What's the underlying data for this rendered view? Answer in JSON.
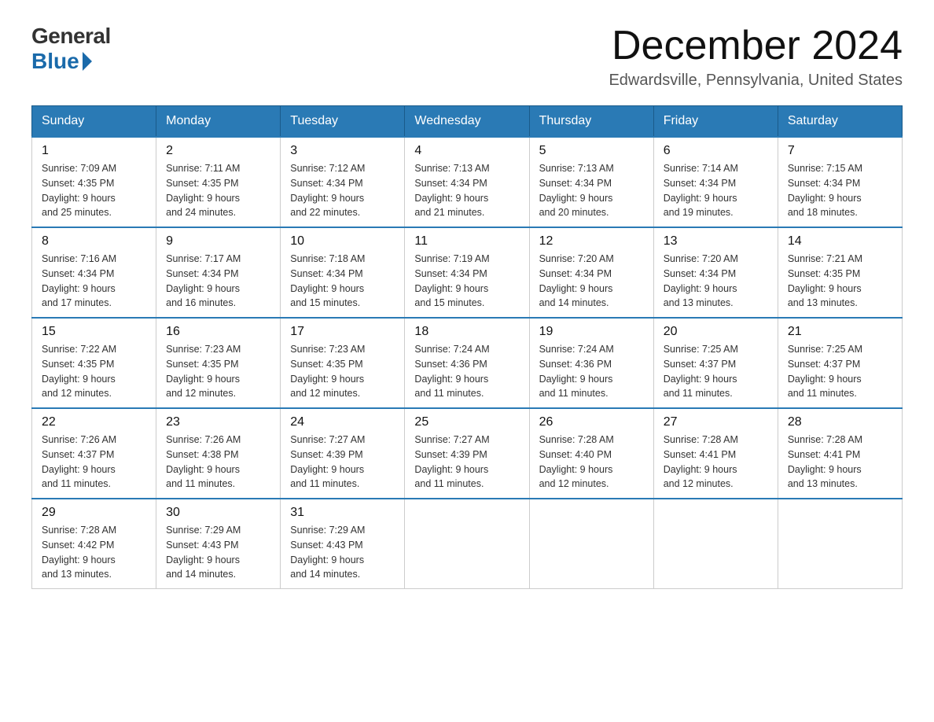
{
  "header": {
    "logo": {
      "general": "General",
      "blue": "Blue"
    },
    "title": "December 2024",
    "location": "Edwardsville, Pennsylvania, United States"
  },
  "days_of_week": [
    "Sunday",
    "Monday",
    "Tuesday",
    "Wednesday",
    "Thursday",
    "Friday",
    "Saturday"
  ],
  "weeks": [
    [
      {
        "day": "1",
        "sunrise": "7:09 AM",
        "sunset": "4:35 PM",
        "daylight": "9 hours and 25 minutes."
      },
      {
        "day": "2",
        "sunrise": "7:11 AM",
        "sunset": "4:35 PM",
        "daylight": "9 hours and 24 minutes."
      },
      {
        "day": "3",
        "sunrise": "7:12 AM",
        "sunset": "4:34 PM",
        "daylight": "9 hours and 22 minutes."
      },
      {
        "day": "4",
        "sunrise": "7:13 AM",
        "sunset": "4:34 PM",
        "daylight": "9 hours and 21 minutes."
      },
      {
        "day": "5",
        "sunrise": "7:13 AM",
        "sunset": "4:34 PM",
        "daylight": "9 hours and 20 minutes."
      },
      {
        "day": "6",
        "sunrise": "7:14 AM",
        "sunset": "4:34 PM",
        "daylight": "9 hours and 19 minutes."
      },
      {
        "day": "7",
        "sunrise": "7:15 AM",
        "sunset": "4:34 PM",
        "daylight": "9 hours and 18 minutes."
      }
    ],
    [
      {
        "day": "8",
        "sunrise": "7:16 AM",
        "sunset": "4:34 PM",
        "daylight": "9 hours and 17 minutes."
      },
      {
        "day": "9",
        "sunrise": "7:17 AM",
        "sunset": "4:34 PM",
        "daylight": "9 hours and 16 minutes."
      },
      {
        "day": "10",
        "sunrise": "7:18 AM",
        "sunset": "4:34 PM",
        "daylight": "9 hours and 15 minutes."
      },
      {
        "day": "11",
        "sunrise": "7:19 AM",
        "sunset": "4:34 PM",
        "daylight": "9 hours and 15 minutes."
      },
      {
        "day": "12",
        "sunrise": "7:20 AM",
        "sunset": "4:34 PM",
        "daylight": "9 hours and 14 minutes."
      },
      {
        "day": "13",
        "sunrise": "7:20 AM",
        "sunset": "4:34 PM",
        "daylight": "9 hours and 13 minutes."
      },
      {
        "day": "14",
        "sunrise": "7:21 AM",
        "sunset": "4:35 PM",
        "daylight": "9 hours and 13 minutes."
      }
    ],
    [
      {
        "day": "15",
        "sunrise": "7:22 AM",
        "sunset": "4:35 PM",
        "daylight": "9 hours and 12 minutes."
      },
      {
        "day": "16",
        "sunrise": "7:23 AM",
        "sunset": "4:35 PM",
        "daylight": "9 hours and 12 minutes."
      },
      {
        "day": "17",
        "sunrise": "7:23 AM",
        "sunset": "4:35 PM",
        "daylight": "9 hours and 12 minutes."
      },
      {
        "day": "18",
        "sunrise": "7:24 AM",
        "sunset": "4:36 PM",
        "daylight": "9 hours and 11 minutes."
      },
      {
        "day": "19",
        "sunrise": "7:24 AM",
        "sunset": "4:36 PM",
        "daylight": "9 hours and 11 minutes."
      },
      {
        "day": "20",
        "sunrise": "7:25 AM",
        "sunset": "4:37 PM",
        "daylight": "9 hours and 11 minutes."
      },
      {
        "day": "21",
        "sunrise": "7:25 AM",
        "sunset": "4:37 PM",
        "daylight": "9 hours and 11 minutes."
      }
    ],
    [
      {
        "day": "22",
        "sunrise": "7:26 AM",
        "sunset": "4:37 PM",
        "daylight": "9 hours and 11 minutes."
      },
      {
        "day": "23",
        "sunrise": "7:26 AM",
        "sunset": "4:38 PM",
        "daylight": "9 hours and 11 minutes."
      },
      {
        "day": "24",
        "sunrise": "7:27 AM",
        "sunset": "4:39 PM",
        "daylight": "9 hours and 11 minutes."
      },
      {
        "day": "25",
        "sunrise": "7:27 AM",
        "sunset": "4:39 PM",
        "daylight": "9 hours and 11 minutes."
      },
      {
        "day": "26",
        "sunrise": "7:28 AM",
        "sunset": "4:40 PM",
        "daylight": "9 hours and 12 minutes."
      },
      {
        "day": "27",
        "sunrise": "7:28 AM",
        "sunset": "4:41 PM",
        "daylight": "9 hours and 12 minutes."
      },
      {
        "day": "28",
        "sunrise": "7:28 AM",
        "sunset": "4:41 PM",
        "daylight": "9 hours and 13 minutes."
      }
    ],
    [
      {
        "day": "29",
        "sunrise": "7:28 AM",
        "sunset": "4:42 PM",
        "daylight": "9 hours and 13 minutes."
      },
      {
        "day": "30",
        "sunrise": "7:29 AM",
        "sunset": "4:43 PM",
        "daylight": "9 hours and 14 minutes."
      },
      {
        "day": "31",
        "sunrise": "7:29 AM",
        "sunset": "4:43 PM",
        "daylight": "9 hours and 14 minutes."
      },
      null,
      null,
      null,
      null
    ]
  ],
  "labels": {
    "sunrise": "Sunrise:",
    "sunset": "Sunset:",
    "daylight": "Daylight:"
  }
}
